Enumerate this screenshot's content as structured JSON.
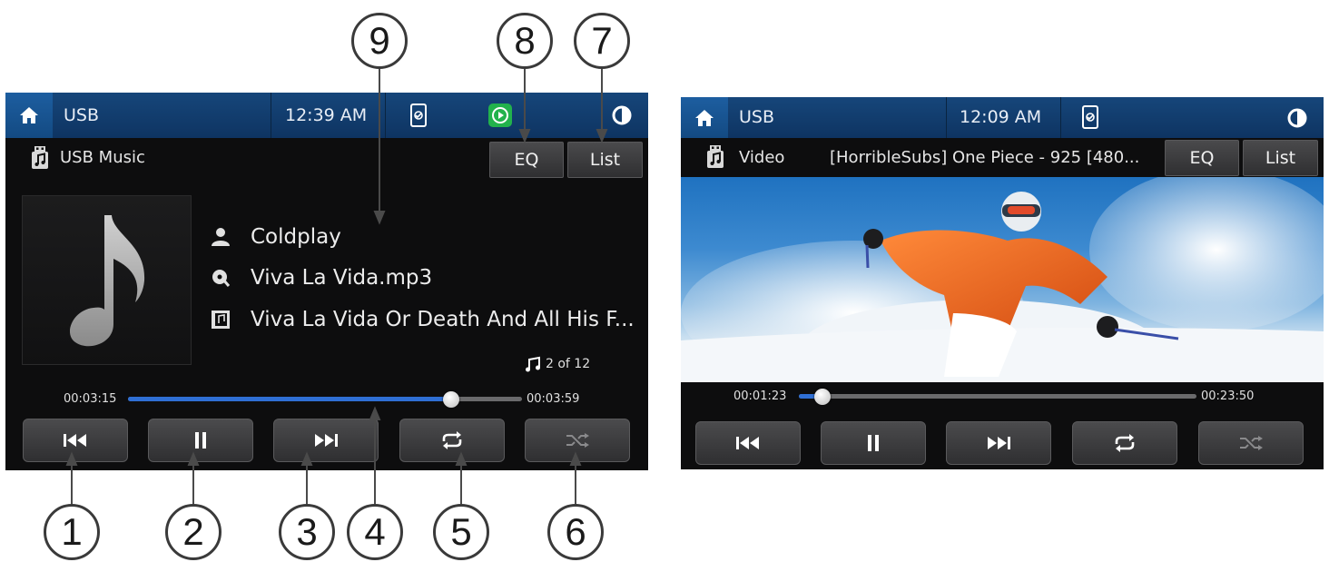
{
  "music_screen": {
    "status_bar": {
      "source": "USB",
      "clock": "12:39 AM"
    },
    "source_label": "USB Music",
    "buttons": {
      "eq": "EQ",
      "list": "List"
    },
    "track": {
      "artist": "Coldplay",
      "file": "Viva La Vida.mp3",
      "album": "Viva La Vida Or Death And All His F..."
    },
    "track_count": "2 of 12",
    "progress": {
      "elapsed": "00:03:15",
      "total": "00:03:59",
      "fraction": 0.82
    }
  },
  "video_screen": {
    "status_bar": {
      "source": "USB",
      "clock": "12:09 AM"
    },
    "source_label": "Video",
    "title": "[HorribleSubs] One Piece - 925 [480...",
    "buttons": {
      "eq": "EQ",
      "list": "List"
    },
    "progress": {
      "elapsed": "00:01:23",
      "total": "00:23:50",
      "fraction": 0.06
    }
  },
  "callouts": [
    "1",
    "2",
    "3",
    "4",
    "5",
    "6",
    "7",
    "8",
    "9"
  ],
  "colors": {
    "status_bar": "#134a82",
    "progress": "#2f6fd4",
    "play_badge": "#22b24c"
  }
}
